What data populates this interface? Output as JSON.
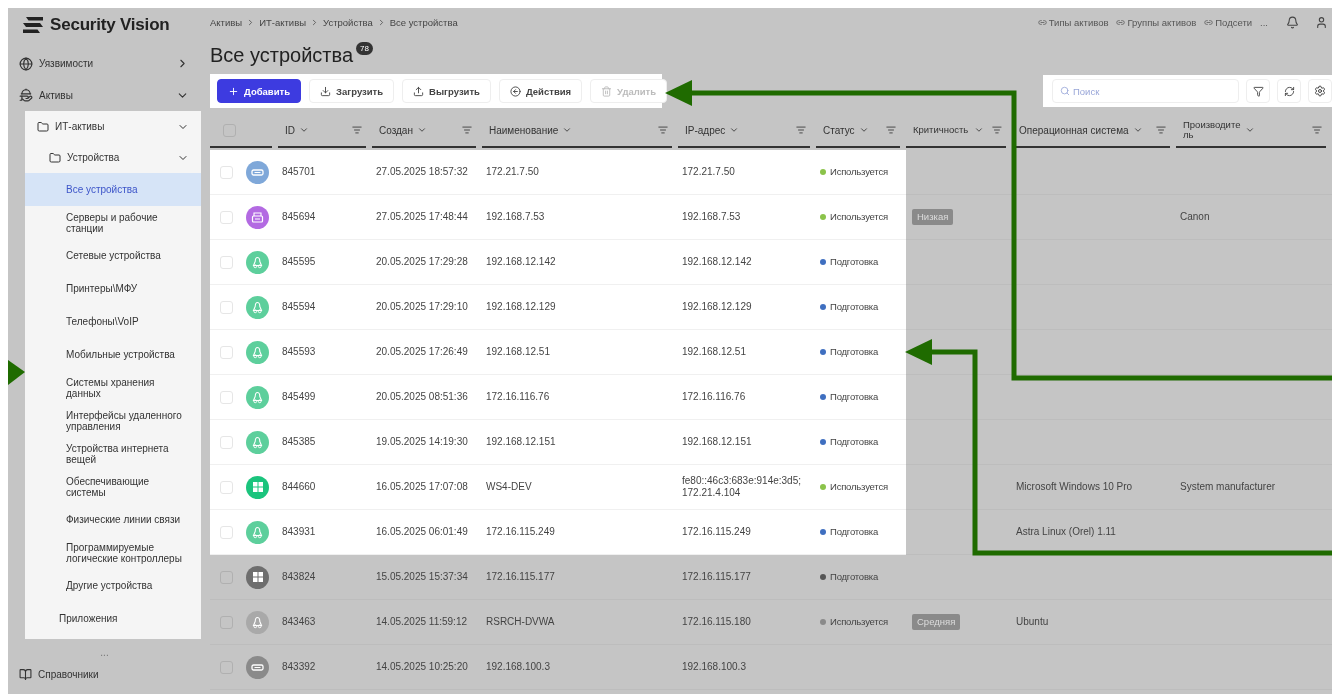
{
  "logo": {
    "text": "Security Vision"
  },
  "sidebar": {
    "items": [
      {
        "label": "Уязвимости",
        "expanded": false
      },
      {
        "label": "Активы",
        "expanded": true,
        "children": [
          {
            "label": "ИТ-активы",
            "expanded": true,
            "children": [
              {
                "label": "Устройства",
                "expanded": true,
                "children": [
                  {
                    "label": "Все устройства",
                    "selected": true
                  },
                  {
                    "label": "Серверы и рабочие станции",
                    "selected": false
                  },
                  {
                    "label": "Сетевые устройства",
                    "selected": false
                  },
                  {
                    "label": "Принтеры\\МФУ",
                    "selected": false
                  },
                  {
                    "label": "Телефоны\\VoIP",
                    "selected": false
                  },
                  {
                    "label": "Мобильные устройства",
                    "selected": false
                  },
                  {
                    "label": "Системы хранения данных",
                    "selected": false
                  },
                  {
                    "label": "Интерфейсы удаленного управления",
                    "selected": false
                  },
                  {
                    "label": "Устройства интернета вещей",
                    "selected": false
                  },
                  {
                    "label": "Обеспечивающие системы",
                    "selected": false
                  },
                  {
                    "label": "Физические линии связи",
                    "selected": false
                  },
                  {
                    "label": "Программируемые логические контроллеры",
                    "selected": false
                  },
                  {
                    "label": "Другие устройства",
                    "selected": false
                  }
                ]
              },
              {
                "label": "Приложения",
                "selected": false
              }
            ]
          }
        ]
      },
      {
        "label": "Справочники",
        "expanded": false
      }
    ],
    "more_indicator": "..."
  },
  "breadcrumbs": [
    "Активы",
    "ИТ-активы",
    "Устройства",
    "Все устройства"
  ],
  "top_links": [
    "Типы активов",
    "Группы активов",
    "Подсети"
  ],
  "top_more": "...",
  "title": "Все устройства",
  "count": "78",
  "toolbar": [
    {
      "label": "Добавить",
      "kind": "primary",
      "disabled": false
    },
    {
      "label": "Загрузить",
      "kind": "plain",
      "disabled": false
    },
    {
      "label": "Выгрузить",
      "kind": "plain",
      "disabled": false
    },
    {
      "label": "Действия",
      "kind": "plain",
      "disabled": false
    },
    {
      "label": "Удалить",
      "kind": "plain",
      "disabled": true
    }
  ],
  "search": {
    "placeholder": "Поиск"
  },
  "table": {
    "select_all_checked": false,
    "columns": [
      "ID",
      "Создан",
      "Наименование",
      "IP-адрес",
      "Статус",
      "Критичность",
      "Операционная система",
      "Производитель"
    ],
    "rows": [
      {
        "highlighted": true,
        "checked": false,
        "kind": "network",
        "id": "845701",
        "created": "27.05.2025 18:57:32",
        "name": "172.21.7.50",
        "ip": "172.21.7.50",
        "status": {
          "text": "Используется",
          "color": "#8bc34a"
        }
      },
      {
        "highlighted": true,
        "checked": false,
        "kind": "printer",
        "id": "845694",
        "created": "27.05.2025 17:48:44",
        "name": "192.168.7.53",
        "ip": "192.168.7.53",
        "status": {
          "text": "Используется",
          "color": "#8bc34a"
        },
        "criticality": "Низкая",
        "vendor": "Canon"
      },
      {
        "highlighted": true,
        "checked": false,
        "kind": "linux",
        "id": "845595",
        "created": "20.05.2025 17:29:28",
        "name": "192.168.12.142",
        "ip": "192.168.12.142",
        "status": {
          "text": "Подготовка",
          "color": "#3f6fc0"
        }
      },
      {
        "highlighted": true,
        "checked": false,
        "kind": "linux",
        "id": "845594",
        "created": "20.05.2025 17:29:10",
        "name": "192.168.12.129",
        "ip": "192.168.12.129",
        "status": {
          "text": "Подготовка",
          "color": "#3f6fc0"
        }
      },
      {
        "highlighted": true,
        "checked": false,
        "kind": "linux",
        "id": "845593",
        "created": "20.05.2025 17:26:49",
        "name": "192.168.12.51",
        "ip": "192.168.12.51",
        "status": {
          "text": "Подготовка",
          "color": "#3f6fc0"
        }
      },
      {
        "highlighted": true,
        "checked": false,
        "kind": "linux",
        "id": "845499",
        "created": "20.05.2025 08:51:36",
        "name": "172.16.116.76",
        "ip": "172.16.116.76",
        "status": {
          "text": "Подготовка",
          "color": "#3f6fc0"
        }
      },
      {
        "highlighted": true,
        "checked": false,
        "kind": "linux",
        "id": "845385",
        "created": "19.05.2025 14:19:30",
        "name": "192.168.12.151",
        "ip": "192.168.12.151",
        "status": {
          "text": "Подготовка",
          "color": "#3f6fc0"
        }
      },
      {
        "highlighted": true,
        "checked": false,
        "kind": "windows",
        "id": "844660",
        "created": "16.05.2025 17:07:08",
        "name": "WS4-DEV",
        "ip": "fe80::46c3:683e:914e:3d5; 172.21.4.104",
        "status": {
          "text": "Используется",
          "color": "#8bc34a"
        },
        "os": "Microsoft Windows 10 Pro",
        "vendor": "System manufacturer"
      },
      {
        "highlighted": true,
        "checked": false,
        "kind": "linux",
        "id": "843931",
        "created": "16.05.2025 06:01:49",
        "name": "172.16.115.249",
        "ip": "172.16.115.249",
        "status": {
          "text": "Подготовка",
          "color": "#3f6fc0"
        },
        "os": "Astra Linux (Orel) 1.11"
      },
      {
        "highlighted": false,
        "checked": false,
        "kind": "windows",
        "id": "843824",
        "created": "15.05.2025 15:37:34",
        "name": "172.16.115.177",
        "ip": "172.16.115.177",
        "status": {
          "text": "Подготовка",
          "color": "#555555"
        }
      },
      {
        "highlighted": false,
        "checked": false,
        "kind": "linux",
        "id": "843463",
        "created": "14.05.2025 11:59:12",
        "name": "RSRCH-DVWA",
        "ip": "172.16.115.180",
        "status": {
          "text": "Используется",
          "color": "#8a8a8a"
        },
        "criticality": "Средняя",
        "os": "Ubuntu"
      },
      {
        "highlighted": false,
        "checked": false,
        "kind": "network",
        "id": "843392",
        "created": "14.05.2025 10:25:20",
        "name": "192.168.100.3",
        "ip": "192.168.100.3"
      }
    ]
  }
}
